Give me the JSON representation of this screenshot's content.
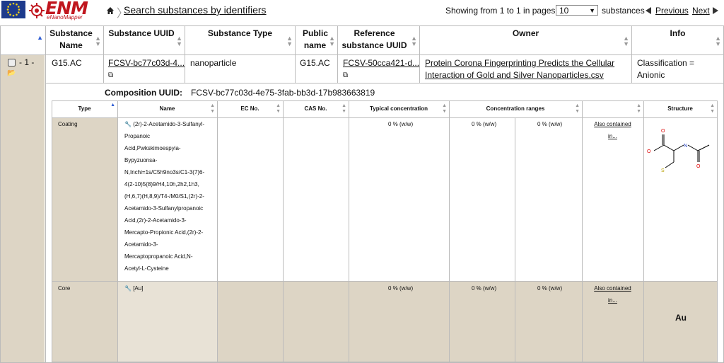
{
  "header": {
    "logo_text": "ENM",
    "logo_subtext": "eNanoMapper",
    "breadcrumb": "Search substances by identifiers",
    "paging_prefix": "Showing from 1 to 1 in pages of",
    "page_size": "10",
    "paging_suffix": "substances",
    "prev_label": "Previous",
    "next_label": "Next"
  },
  "table": {
    "columns": [
      "Substance Name",
      "Substance UUID",
      "Substance Type",
      "Public name",
      "Reference substance UUID",
      "Owner",
      "Info"
    ],
    "row": {
      "index": "- 1 -",
      "name": "G15.AC",
      "uuid": "FCSV-bc77c03d-4...",
      "type": "nanoparticle",
      "public_name": "G15.AC",
      "ref_uuid": "FCSV-50cca421-d...",
      "owner_line1": "Protein Corona Fingerprinting Predicts the Cellular",
      "owner_line2": "Interaction of Gold and Silver Nanoparticles.csv",
      "info": "Classification = Anionic"
    }
  },
  "composition": {
    "label": "Composition UUID:",
    "uuid": "FCSV-bc77c03d-4e75-3fab-bb3d-17b983663819",
    "columns": [
      "Type",
      "Name",
      "EC No.",
      "CAS No.",
      "Typical concentration",
      "Concentration ranges",
      "Structure"
    ],
    "rows": [
      {
        "type": "Coating",
        "name_lines": [
          "(2r)-2-Acetamido-3-Sulfanyl-",
          "Propanoic",
          "Acid,Pwkskimoespyia-",
          "Bypyzuonsa-",
          "N,Inchi=1s/C5h9no3s/C1-3(7)6-",
          "4(2-10)5(8)9/H4,10h,2h2,1h3,",
          "(H,6,7)(H,8,9)/T4-/M0/S1,(2r)-2-",
          "Acetamido-3-Sulfanylpropanoic",
          "Acid,(2r)-2-Acetamido-3-",
          "Mercapto-Propionic Acid,(2r)-2-",
          "Acetamido-3-",
          "Mercaptopropanoic Acid,N-",
          "Acetyl-L-Cysteine"
        ],
        "typical": "0 % (w/w)",
        "range_low": "0 % (w/w)",
        "range_high": "0 % (w/w)",
        "also_line1": "Also contained",
        "also_line2": "in..."
      },
      {
        "type": "Core",
        "name_lines": [
          "[Au]"
        ],
        "typical": "0 % (w/w)",
        "range_low": "0 % (w/w)",
        "range_high": "0 % (w/w)",
        "also_line1": "Also contained",
        "also_line2": "in...",
        "structure_text": "Au"
      }
    ],
    "structure_atoms": {
      "o": "O",
      "n": "N",
      "s": "S"
    }
  },
  "colors": {
    "shade": "#ddd5c5",
    "logo": "#c0161e",
    "eu_blue": "#1d3a8c",
    "sort_active": "#2b5bd3"
  }
}
